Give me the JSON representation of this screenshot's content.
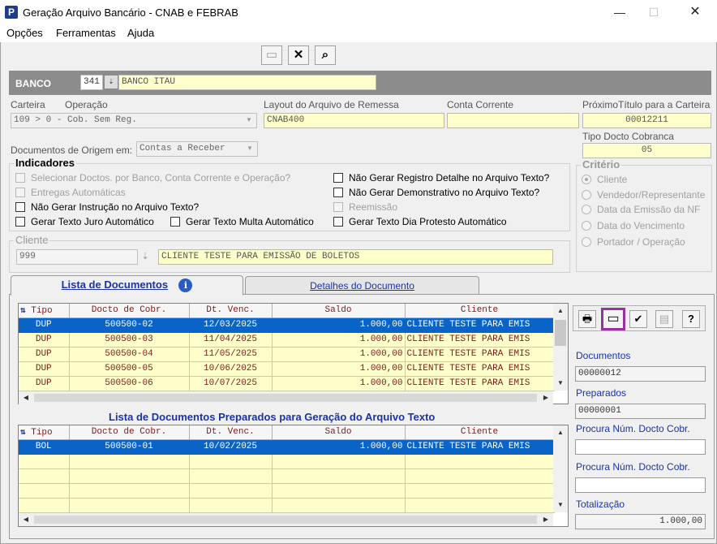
{
  "window": {
    "title": "Geração Arquivo Bancário - CNAB e FEBRAB",
    "app_icon": "P",
    "minimize": "—",
    "maximize": "☐",
    "close": "✕"
  },
  "menu": {
    "opcoes": "Opções",
    "ferramentas": "Ferramentas",
    "ajuda": "Ajuda"
  },
  "toolbar": {
    "new_icon": "▭",
    "delete_icon": "✕",
    "search_icon": "⌕"
  },
  "banco": {
    "label": "BANCO",
    "code": "341",
    "name": "BANCO ITAU"
  },
  "carteira": {
    "label": "Carteira",
    "operacao_label": "Operação",
    "value": "109   > 0 - Cob. Sem Reg."
  },
  "layout": {
    "label": "Layout do Arquivo de Remessa",
    "value": "CNAB400"
  },
  "conta": {
    "label": "Conta Corrente",
    "value": ""
  },
  "proximo": {
    "label": "PróximoTítulo para a Carteira",
    "value": "00012211"
  },
  "tipo_docto": {
    "label": "Tipo Docto Cobranca",
    "value": "05"
  },
  "origem": {
    "label": "Documentos de Origem em:",
    "value": "Contas a Receber"
  },
  "indicadores": {
    "title": "Indicadores",
    "selecionar": "Selecionar Doctos. por Banco, Conta Corrente  e Operação?",
    "entregas": "Entregas Automáticas",
    "nao_instrucao": "Não Gerar Instrução no Arquivo Texto?",
    "juro": "Gerar Texto Juro Automático",
    "multa": "Gerar Texto Multa Automático",
    "nao_registro": "Não Gerar Registro Detalhe no Arquivo Texto?",
    "nao_demonstrativo": "Não Gerar Demonstrativo no Arquivo Texto?",
    "reemissao": "Reemissão",
    "protesto": "Gerar Texto Dia Protesto Automático"
  },
  "criterio": {
    "title": "Critério",
    "options": [
      "Cliente",
      "Vendedor/Representante",
      "Data da Emissão da NF",
      "Data do Vencimento",
      "Portador / Operação"
    ]
  },
  "cliente": {
    "label": "Cliente",
    "code": "999",
    "name": "CLIENTE TESTE PARA EMISSÃO DE BOLETOS"
  },
  "tabs": {
    "lista": "Lista de Documentos",
    "detalhes": "Detalhes do Documento",
    "info_icon": "i"
  },
  "columns": [
    "Tipo",
    "Docto de Cobr.",
    "Dt. Venc.",
    "Saldo",
    "Cliente"
  ],
  "documentos": [
    [
      "DUP",
      "500500-02",
      "12/03/2025",
      "1.000,00",
      "CLIENTE TESTE PARA EMIS"
    ],
    [
      "DUP",
      "500500-03",
      "11/04/2025",
      "1.000,00",
      "CLIENTE TESTE PARA EMIS"
    ],
    [
      "DUP",
      "500500-04",
      "11/05/2025",
      "1.000,00",
      "CLIENTE TESTE PARA EMIS"
    ],
    [
      "DUP",
      "500500-05",
      "10/06/2025",
      "1.000,00",
      "CLIENTE TESTE PARA EMIS"
    ],
    [
      "DUP",
      "500500-06",
      "10/07/2025",
      "1.000,00",
      "CLIENTE TESTE PARA EMIS"
    ]
  ],
  "preparados_title": "Lista de Documentos Preparados para Geração do Arquivo Texto",
  "preparados": [
    [
      "BOL",
      "500500-01",
      "10/02/2025",
      "1.000,00",
      "CLIENTE TESTE PARA EMIS"
    ]
  ],
  "right": {
    "print_icon": "🖶",
    "window_icon": "▭",
    "check_icon": "✔",
    "doc_icon": "▤",
    "help": "?",
    "documentos_label": "Documentos",
    "documentos_value": "00000012",
    "preparados_label": "Preparados",
    "preparados_value": "00000001",
    "procura1_label": "Procura Núm. Docto Cobr.",
    "procura1_value": "",
    "procura2_label": "Procura Núm. Docto Cobr.",
    "procura2_value": "",
    "totalizacao_label": "Totalização",
    "totalizacao_value": "1.000,00"
  }
}
